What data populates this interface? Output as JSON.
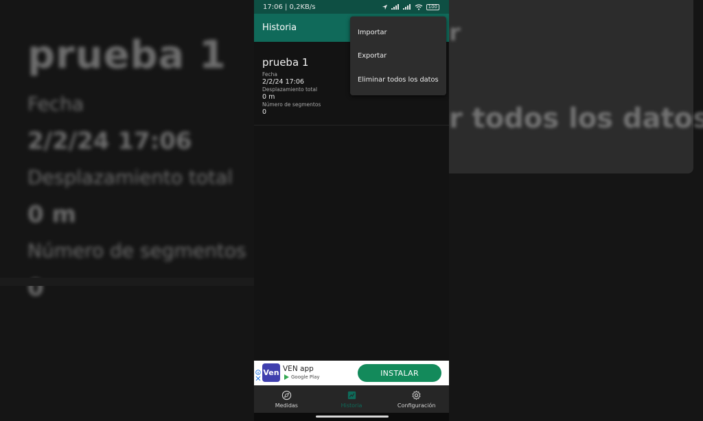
{
  "status_bar": {
    "time": "17:06 | 0,2KB/s",
    "battery": "100"
  },
  "app_bar": {
    "title": "Historia"
  },
  "overflow_menu": {
    "items": [
      "Importar",
      "Exportar",
      "Eliminar todos los datos"
    ]
  },
  "record": {
    "name": "prueba 1",
    "date_label": "Fecha",
    "date_value": "2/2/24 17:06",
    "displacement_label": "Desplazamiento total",
    "displacement_value": "0 m",
    "segments_label": "Número de segmentos",
    "segments_value": "0"
  },
  "ad": {
    "logo_text": "Ven",
    "app_name": "VEN app",
    "store": "Google Play",
    "install_label": "INSTALAR"
  },
  "bottom_nav": {
    "tabs": [
      {
        "label": "Medidas",
        "icon": "compass-icon",
        "active": false
      },
      {
        "label": "Historia",
        "icon": "history-icon",
        "active": true
      },
      {
        "label": "Configuración",
        "icon": "gear-icon",
        "active": false
      }
    ]
  },
  "backdrop_right": {
    "fragment_top": "r",
    "fragment_mid": "r todos los datos"
  },
  "colors": {
    "status_bar": "#0e4f43",
    "app_bar": "#106a5a",
    "accent": "#0e6b5a",
    "install_button": "#138a5b"
  }
}
